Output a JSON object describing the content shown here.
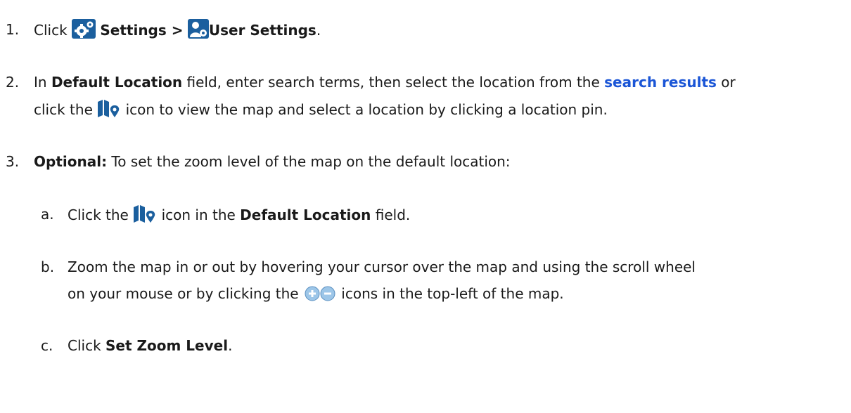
{
  "steps": {
    "s1": {
      "num": "1.",
      "t1": "Click",
      "b1": "Settings >",
      "b2": "User Settings",
      "t2": "."
    },
    "s2": {
      "num": "2.",
      "t1": "In",
      "b1": "Default Location",
      "t2": "field, enter search terms, then select the location from the",
      "link": "search results",
      "t3": "or",
      "t4": "click the",
      "t5": "icon to view the map and select a location by clicking a location pin."
    },
    "s3": {
      "num": "3.",
      "b1": "Optional:",
      "t1": "To set the zoom level of the map on the default location:"
    },
    "sa": {
      "num": "a.",
      "t1": "Click the",
      "t2": "icon in the",
      "b1": "Default Location",
      "t3": "field."
    },
    "sb": {
      "num": "b.",
      "t1": "Zoom the map in or out by hovering your cursor over the map and using the scroll wheel",
      "t2": "on your mouse or by clicking the",
      "t3": "icons in the top-left of the map."
    },
    "sc": {
      "num": "c.",
      "t1": "Click",
      "b1": "Set Zoom Level",
      "t2": "."
    }
  },
  "icons": {
    "settings": "gear-icon",
    "user_settings": "user-settings-icon",
    "map": "map-pin-icon",
    "zoom": "zoom-in-out-icon"
  },
  "colors": {
    "text": "#1a1a1a",
    "link": "#1a55d6",
    "icon_blue": "#1b5f9e"
  }
}
